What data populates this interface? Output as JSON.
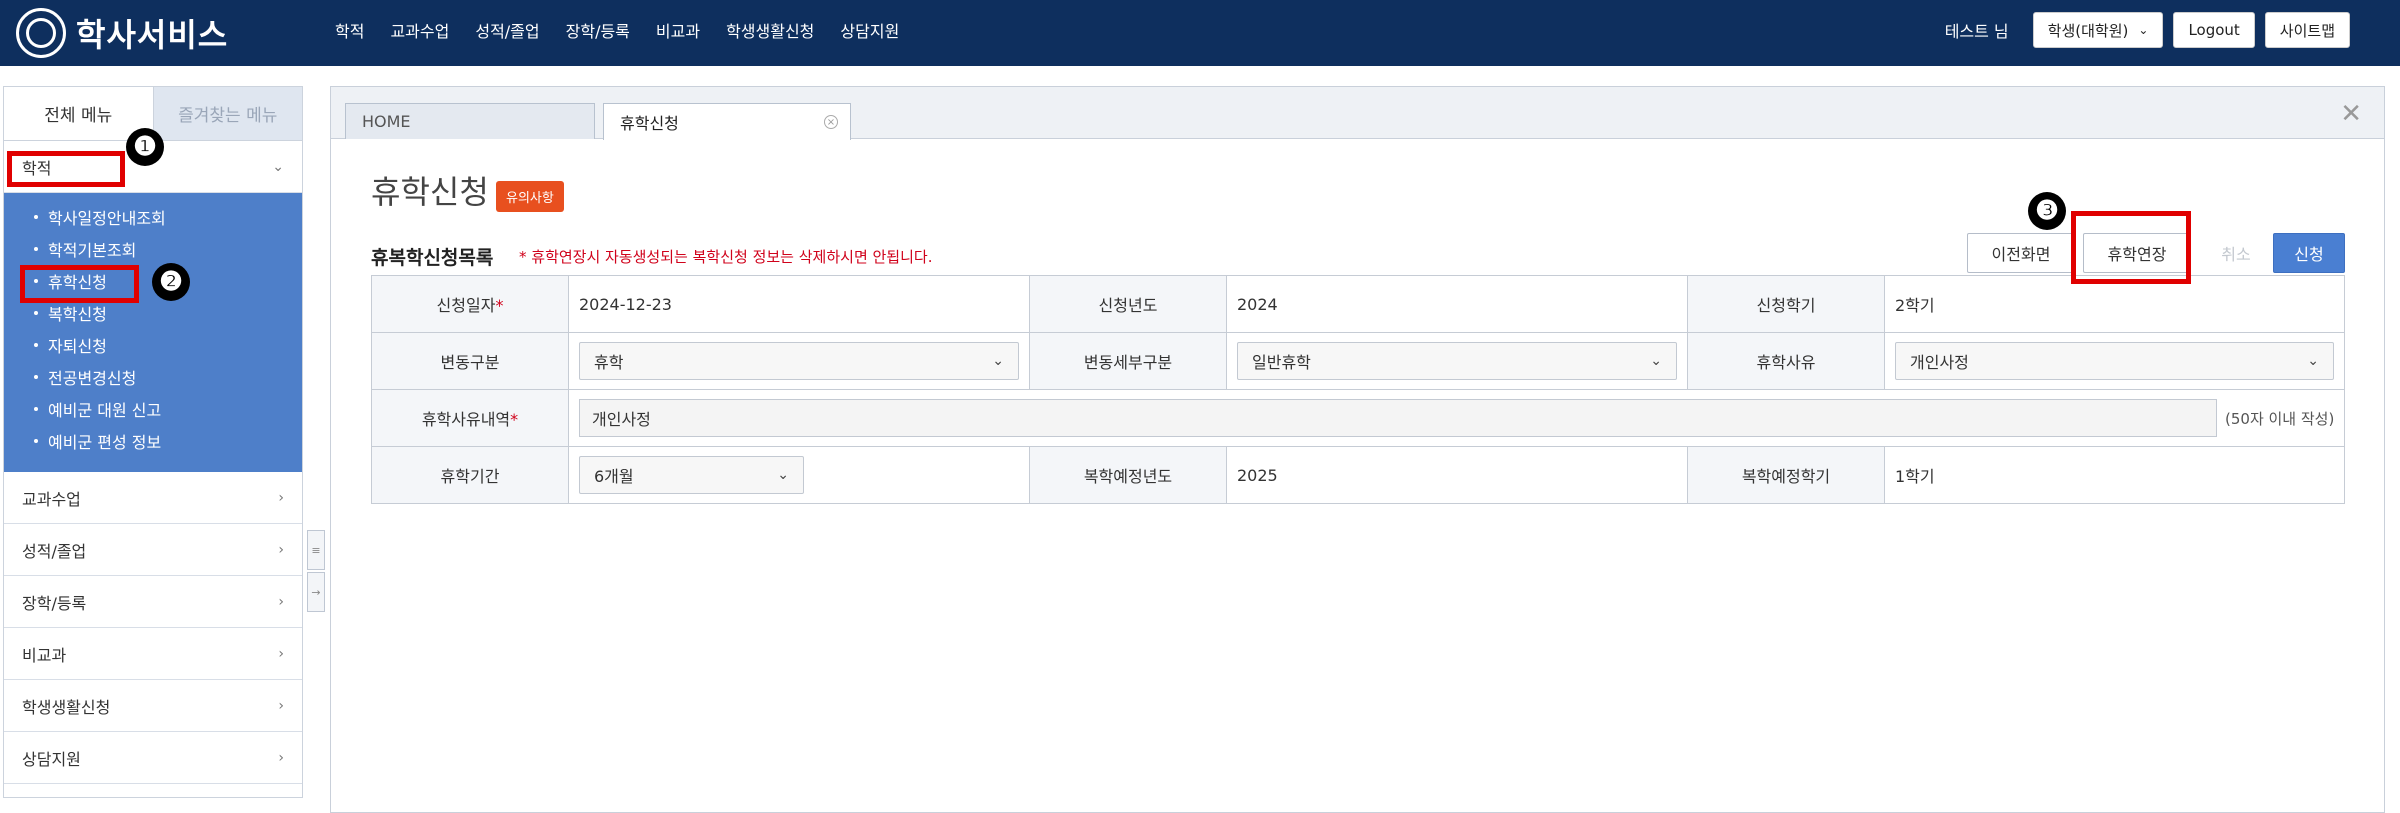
{
  "header": {
    "logo_text": "학사서비스",
    "nav": [
      "학적",
      "교과수업",
      "성적/졸업",
      "장학/등록",
      "비교과",
      "학생생활신청",
      "상담지원"
    ],
    "user_name": "테스트 님",
    "role_select": "학생(대학원)",
    "logout_label": "Logout",
    "sitemap_label": "사이트맵"
  },
  "sidebar": {
    "tab_all": "전체 메뉴",
    "tab_favorites": "즐겨찾는 메뉴",
    "open_group": "학적",
    "sub_items": [
      "학사일정안내조회",
      "학적기본조회",
      "휴학신청",
      "복학신청",
      "자퇴신청",
      "전공변경신청",
      "예비군 대원 신고",
      "예비군 편성 정보"
    ],
    "groups": [
      "교과수업",
      "성적/졸업",
      "장학/등록",
      "비교과",
      "학생생활신청",
      "상담지원"
    ]
  },
  "annotations": {
    "m1": "❶",
    "m2": "❷",
    "m3": "❸"
  },
  "tabs": {
    "home": "HOME",
    "current": "휴학신청"
  },
  "page": {
    "title": "휴학신청",
    "badge": "유의사항",
    "list_title": "휴복학신청목록",
    "note": "* 휴학연장시 자동생성되는 복학신청 정보는 삭제하시면 안됩니다.",
    "buttons": {
      "prev": "이전화면",
      "extend": "휴학연장",
      "cancel": "취소",
      "apply": "신청"
    }
  },
  "form": {
    "apply_date_label": "신청일자",
    "apply_date": "2024-12-23",
    "apply_year_label": "신청년도",
    "apply_year": "2024",
    "apply_term_label": "신청학기",
    "apply_term": "2학기",
    "change_type_label": "변동구분",
    "change_type": "휴학",
    "change_detail_label": "변동세부구분",
    "change_detail": "일반휴학",
    "reason_label": "휴학사유",
    "reason": "개인사정",
    "reason_detail_label": "휴학사유내역",
    "reason_detail": "개인사정",
    "reason_detail_hint": "(50자 이내 작성)",
    "period_label": "휴학기간",
    "period": "6개월",
    "return_year_label": "복학예정년도",
    "return_year": "2025",
    "return_term_label": "복학예정학기",
    "return_term": "1학기",
    "required_mark": "*"
  },
  "colors": {
    "header_bg": "#0e2f5e",
    "submenu_bg": "#4e7fc9",
    "annotation": "#e00000",
    "primary": "#4a7fd2",
    "badge": "#e8501f"
  }
}
